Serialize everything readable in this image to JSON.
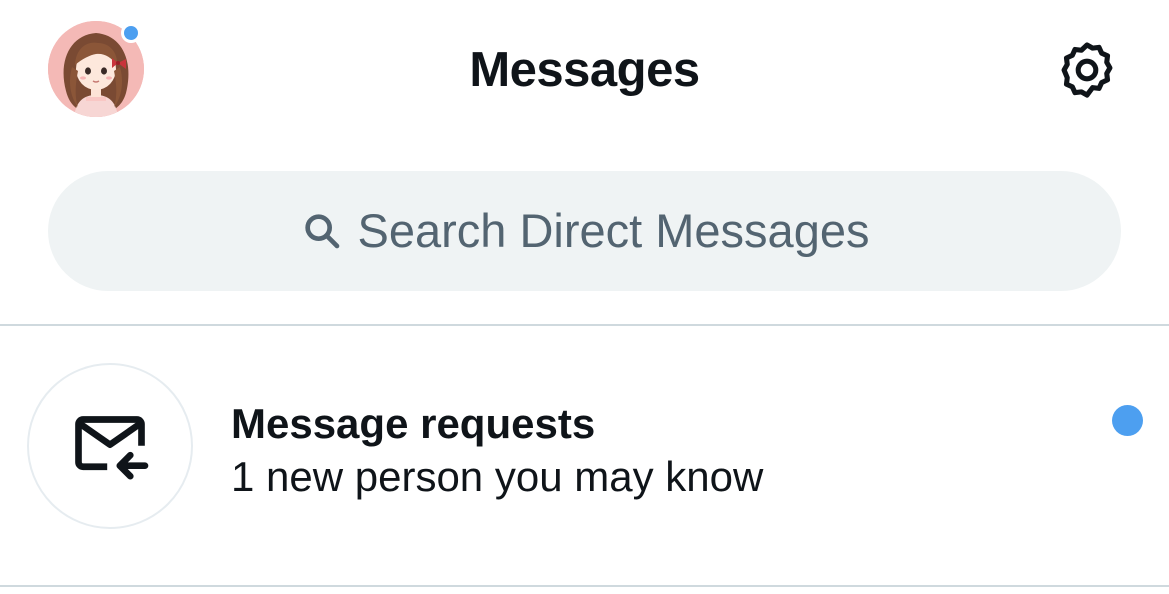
{
  "header": {
    "title": "Messages",
    "avatar_icon": "user-avatar",
    "settings_icon": "gear-icon"
  },
  "search": {
    "placeholder": "Search Direct Messages",
    "icon": "search-icon"
  },
  "requests": {
    "title": "Message requests",
    "subtitle": "1 new person you may know",
    "icon": "mail-incoming-icon",
    "unread": true
  },
  "colors": {
    "accent": "#4d9ff0",
    "text_primary": "#0f1419",
    "text_secondary": "#536471",
    "search_bg": "#eff3f4",
    "divider": "#cfd9de"
  }
}
